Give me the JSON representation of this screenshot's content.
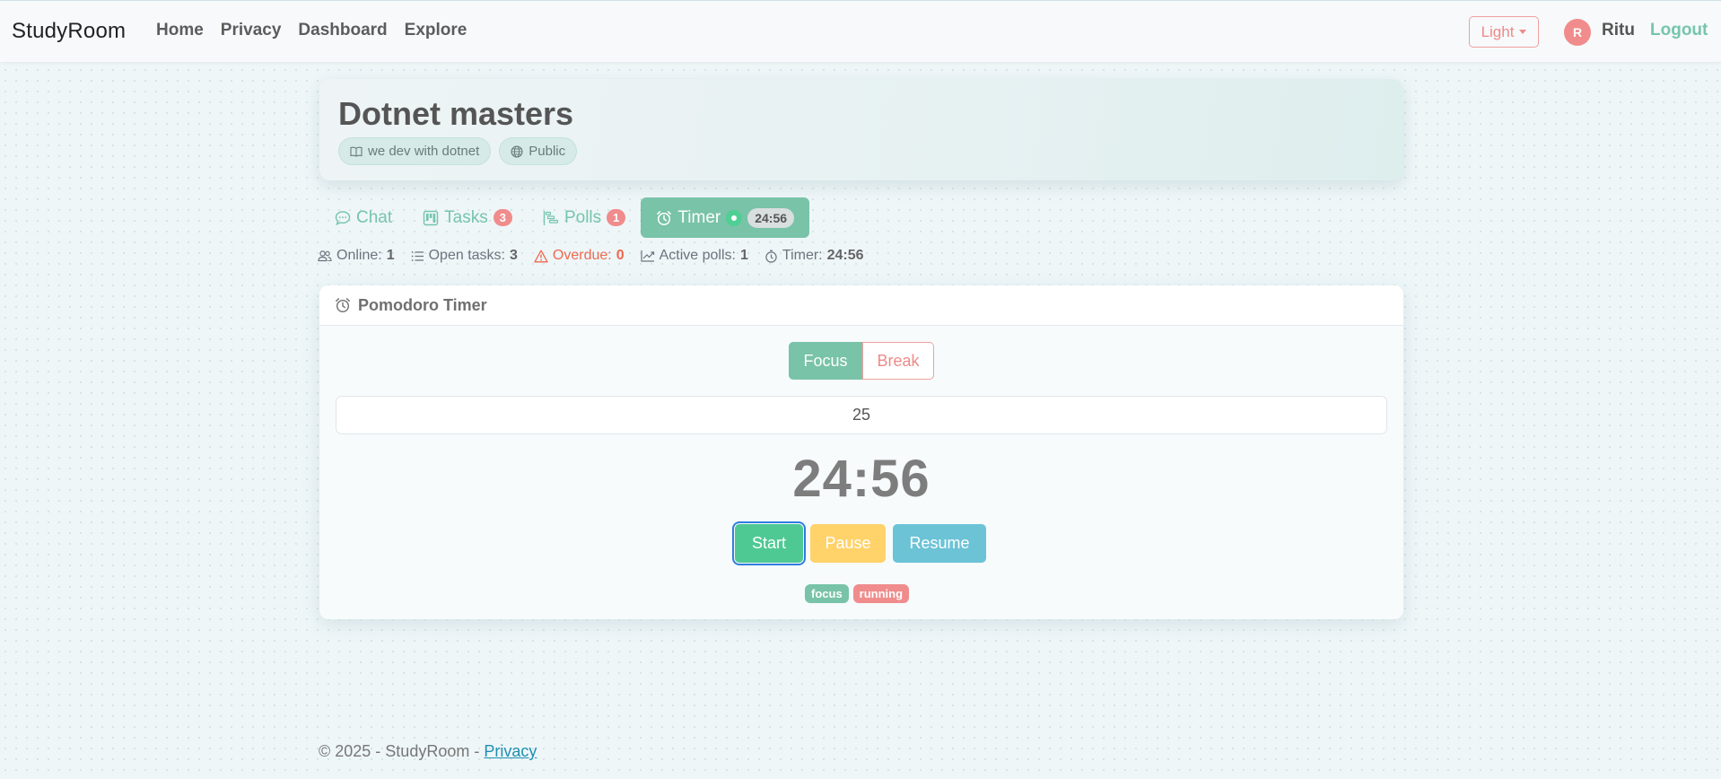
{
  "brand": "StudyRoom",
  "nav": {
    "items": [
      {
        "label": "Home"
      },
      {
        "label": "Privacy"
      },
      {
        "label": "Dashboard"
      },
      {
        "label": "Explore"
      }
    ]
  },
  "theme": {
    "label": "Light"
  },
  "user": {
    "initial": "R",
    "name": "Ritu",
    "logout_label": "Logout"
  },
  "room": {
    "title": "Dotnet masters",
    "chips": [
      {
        "label": "we dev with dotnet",
        "icon": "book-icon"
      },
      {
        "label": "Public",
        "icon": "globe-icon"
      }
    ]
  },
  "tabs": {
    "chat": {
      "label": "Chat"
    },
    "tasks": {
      "label": "Tasks",
      "badge": "3"
    },
    "polls": {
      "label": "Polls",
      "badge": "1"
    },
    "timer": {
      "label": "Timer",
      "time": "24:56"
    }
  },
  "stats": {
    "online": {
      "label": "Online:",
      "value": "1"
    },
    "open_tasks": {
      "label": "Open tasks:",
      "value": "3"
    },
    "overdue": {
      "label": "Overdue:",
      "value": "0"
    },
    "active_polls": {
      "label": "Active polls:",
      "value": "1"
    },
    "timer": {
      "label": "Timer:",
      "value": "24:56"
    }
  },
  "pomodoro": {
    "title": "Pomodoro Timer",
    "modes": {
      "focus": "Focus",
      "break": "Break"
    },
    "minutes": "25",
    "display": "24:56",
    "controls": {
      "start": "Start",
      "pause": "Pause",
      "resume": "Resume"
    },
    "status": {
      "mode": "focus",
      "state": "running"
    }
  },
  "footer": {
    "text": "© 2025 - StudyRoom - ",
    "link": "Privacy"
  },
  "colors": {
    "accent": "#79c3a8",
    "danger": "#f08c8c",
    "warning": "#ffd36a",
    "info": "#6cc3d6",
    "success": "#4fc993"
  }
}
